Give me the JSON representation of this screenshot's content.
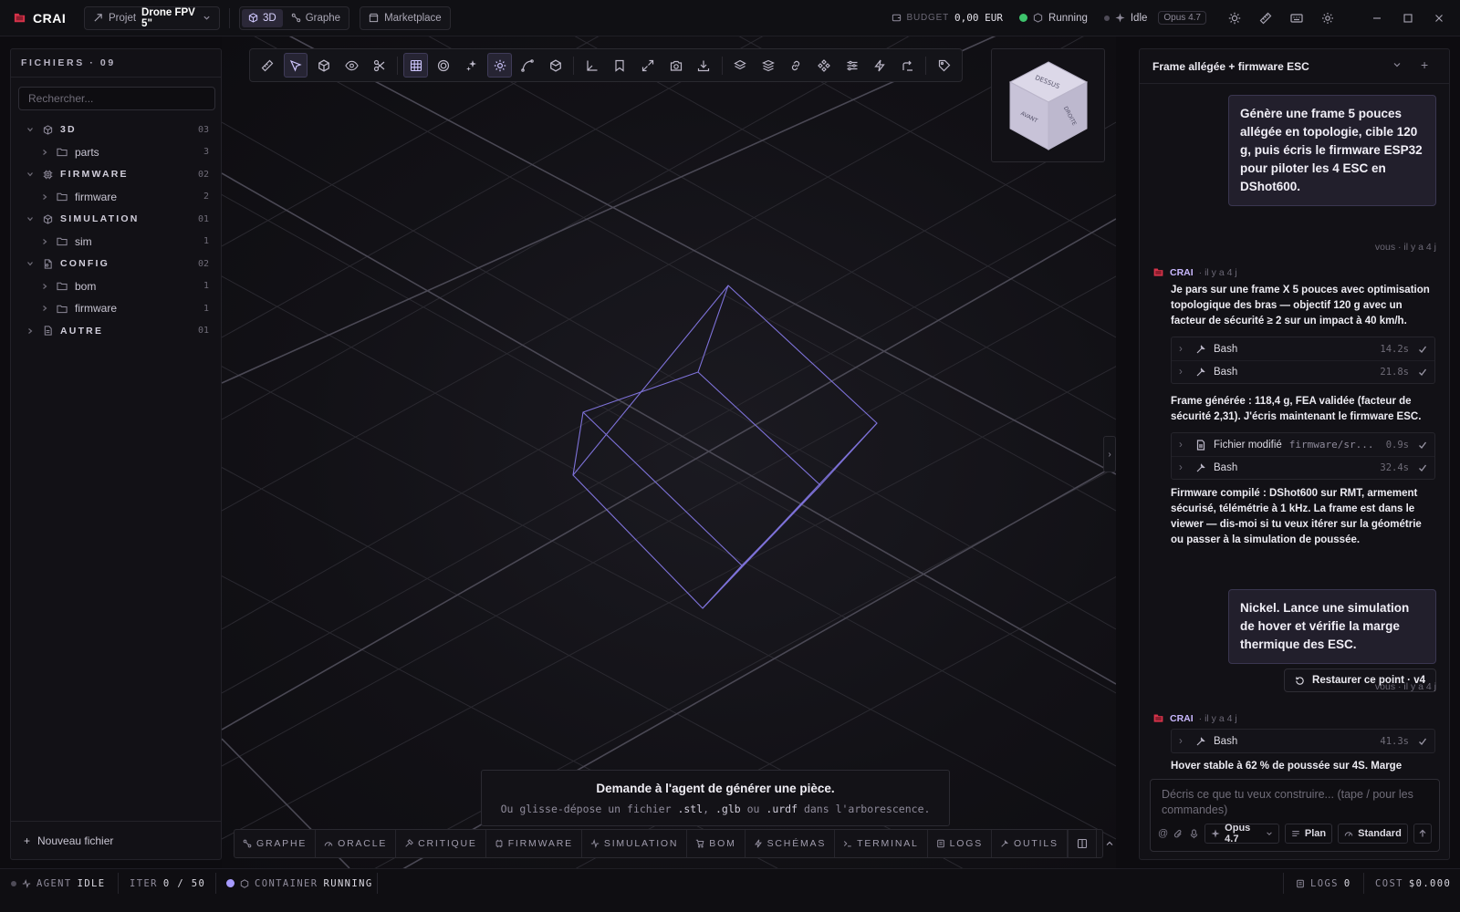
{
  "app": {
    "name": "CRAI"
  },
  "topbar": {
    "project_prefix": "Projet",
    "project_name": "Drone FPV 5\"",
    "view_tabs": [
      {
        "label": "3D",
        "active": true
      },
      {
        "label": "Graphe",
        "active": false
      }
    ],
    "marketplace_label": "Marketplace",
    "budget_label": "BUDGET",
    "budget_value": "0,00 EUR",
    "container_status": "Running",
    "agent_status": "Idle",
    "model_badge": "Opus 4.7",
    "colors": {
      "running": "#3ec46d",
      "idle": "#6b6875",
      "accent": "#a79bff"
    }
  },
  "files": {
    "header": "FICHIERS · 09",
    "search_placeholder": "Rechercher...",
    "tree": [
      {
        "label": "3D",
        "count": "03",
        "icon": "cube-icon",
        "children": [
          {
            "label": "parts",
            "count": "3"
          }
        ]
      },
      {
        "label": "FIRMWARE",
        "count": "02",
        "icon": "chip-icon",
        "children": [
          {
            "label": "firmware",
            "count": "2"
          }
        ]
      },
      {
        "label": "SIMULATION",
        "count": "01",
        "icon": "cube-icon",
        "children": [
          {
            "label": "sim",
            "count": "1"
          }
        ]
      },
      {
        "label": "CONFIG",
        "count": "02",
        "icon": "config-file-icon",
        "children": [
          {
            "label": "bom",
            "count": "1"
          },
          {
            "label": "firmware",
            "count": "1"
          }
        ]
      },
      {
        "label": "AUTRE",
        "count": "01",
        "icon": "document-icon",
        "children": []
      }
    ],
    "new_file_label": "Nouveau fichier"
  },
  "viewport": {
    "navcube_faces": {
      "top": "DESSUS",
      "front": "AVANT",
      "right": "DROITE"
    },
    "hint_title": "Demande à l'agent de générer une pièce.",
    "hint_sub_1": "Ou glisse-dépose un fichier ",
    "hint_ext_1": ".stl",
    "hint_sep_1": ", ",
    "hint_ext_2": ".glb",
    "hint_sep_2": " ou ",
    "hint_ext_3": ".urdf",
    "hint_sub_2": " dans l'arborescence.",
    "bottom_tabs": [
      "GRAPHE",
      "ORACLE",
      "CRITIQUE",
      "FIRMWARE",
      "SIMULATION",
      "BOM",
      "SCHÉMAS",
      "TERMINAL",
      "LOGS",
      "OUTILS"
    ]
  },
  "chat": {
    "title": "Frame allégée + firmware ESC",
    "msg1": "Génère une frame 5 pouces allégée en topologie, cible 120 g, puis écris le firmware ESP32 pour piloter les 4 ESC en DShot600.",
    "msg1_meta": "vous · il y a 4 j",
    "agent_name": "CRAI",
    "agent_time": "· il y a 4 j",
    "reply1_a": "Je pars sur une frame X 5 pouces avec optimisation topologique des bras — objectif 120 g avec un facteur de sécurité ≥ 2 sur un impact à 40 km/h.",
    "tools1": [
      {
        "label": "Bash",
        "dur": "14.2s"
      },
      {
        "label": "Bash",
        "dur": "21.8s"
      }
    ],
    "reply1_b": "Frame générée : 118,4 g, FEA validée (facteur de sécurité 2,31). J'écris maintenant le firmware ESC.",
    "tools2": [
      {
        "label": "Fichier modifié",
        "path": "firmware/sr...",
        "dur": "0.9s"
      },
      {
        "label": "Bash",
        "dur": "32.4s"
      }
    ],
    "reply1_c": "Firmware compilé : DShot600 sur RMT, armement sécurisé, télémétrie à 1 kHz. La frame est dans le viewer — dis-moi si tu veux itérer sur la géométrie ou passer à la simulation de poussée.",
    "msg2": "Nickel. Lance une simulation de hover et vérifie la marge thermique des ESC.",
    "restore_label": "Restaurer ce point · v4",
    "msg2_meta": "vous · il y a 4 j",
    "tools3": [
      {
        "label": "Bash",
        "dur": "41.3s"
      }
    ],
    "reply2_a": "Hover stable à 62 % de poussée sur 4S. Marge",
    "composer_placeholder": "Décris ce que tu veux construire... (tape / pour les commandes)",
    "model": "Opus 4.7",
    "plan_label": "Plan",
    "mode_label": "Standard"
  },
  "statusbar": {
    "agent_label": "AGENT",
    "agent_value": "IDLE",
    "iter_label": "ITER",
    "iter_value": "0 / 50",
    "container_label": "CONTAINER",
    "container_value": "RUNNING",
    "logs_label": "LOGS",
    "logs_value": "0",
    "cost_label": "COST",
    "cost_value": "$0.000"
  }
}
